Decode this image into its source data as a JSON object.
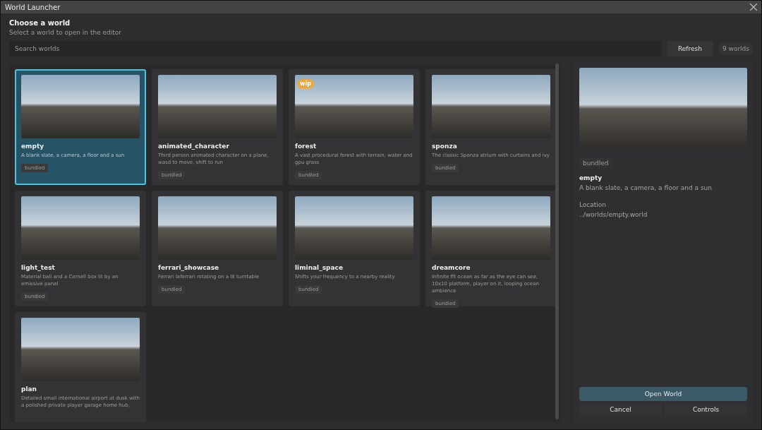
{
  "window": {
    "title": "World Launcher"
  },
  "header": {
    "title": "Choose a world",
    "subtitle": "Select a world to open in the editor"
  },
  "search": {
    "placeholder": "Search worlds"
  },
  "refresh_button": "Refresh",
  "count": "9 worlds",
  "worlds": [
    {
      "name": "empty",
      "description": "A blank slate, a camera, a floor and a sun",
      "tag": "bundled",
      "selected": true
    },
    {
      "name": "animated_character",
      "description": "Third person animated character on a plane, wasd to move, shift to run",
      "tag": "bundled",
      "selected": false
    },
    {
      "name": "forest",
      "description": "A vast procedural forest with terrain, water and gpu grass",
      "tag": "bundled",
      "badge": "wip",
      "selected": false
    },
    {
      "name": "sponza",
      "description": "The classic Sponza atrium with curtains and ivy",
      "tag": "bundled",
      "selected": false
    },
    {
      "name": "light_test",
      "description": "Material ball and a Cornell box lit by an emissive panel",
      "tag": "bundled",
      "selected": false
    },
    {
      "name": "ferrari_showcase",
      "description": "Ferrari laferrari rotating on a lit turntable",
      "tag": "bundled",
      "selected": false
    },
    {
      "name": "liminal_space",
      "description": "Shifts your frequency to a nearby reality",
      "tag": "bundled",
      "selected": false
    },
    {
      "name": "dreamcore",
      "description": "Infinite fft ocean as far as the eye can see, 10x10 platform, player on it, looping ocean ambience",
      "tag": "bundled",
      "selected": false
    },
    {
      "name": "plan",
      "description": "Detailed small international airport at dusk with a polished private player garage home hub,",
      "selected": false
    }
  ],
  "details": {
    "tag": "bundled",
    "name": "empty",
    "description": "A blank slate, a camera, a floor and a sun",
    "location_label": "Location",
    "location": "../worlds/empty.world"
  },
  "buttons": {
    "primary": "Open World",
    "cancel": "Cancel",
    "controls": "Controls"
  }
}
